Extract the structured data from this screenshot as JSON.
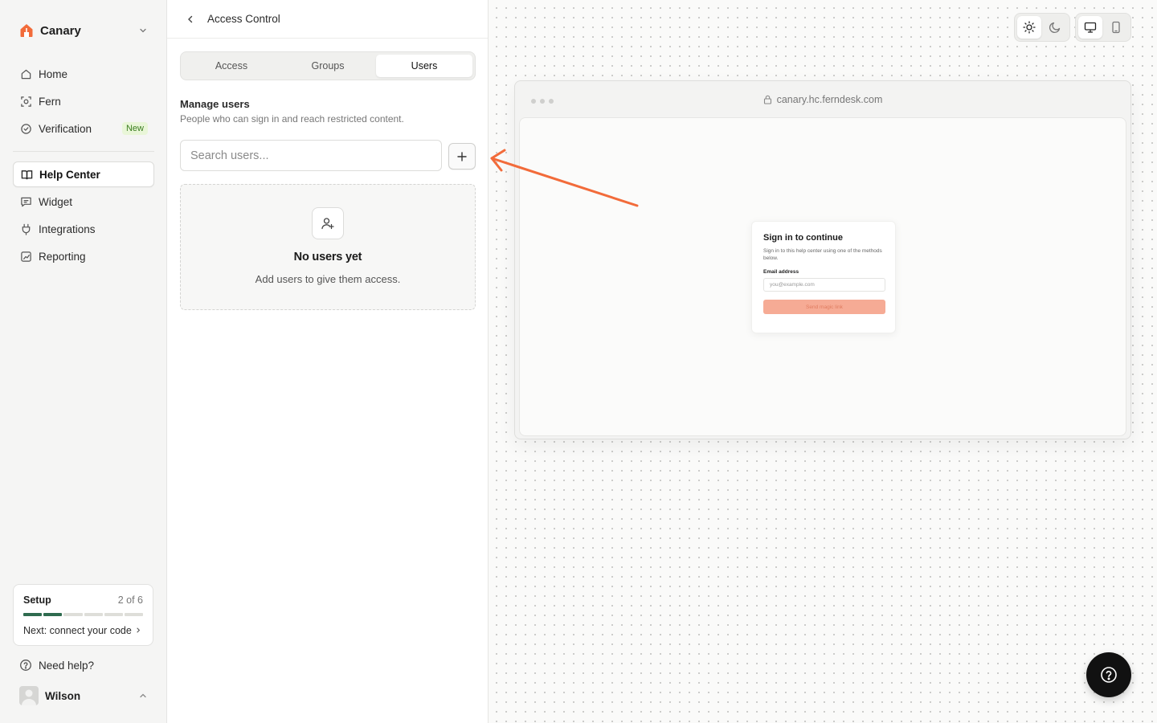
{
  "app": {
    "workspace_name": "Canary",
    "brand_color": "#f26b3a"
  },
  "sidebar": {
    "primary_items": [
      {
        "label": "Home",
        "icon": "home-icon"
      },
      {
        "label": "Fern",
        "icon": "fern-scan-icon"
      },
      {
        "label": "Verification",
        "icon": "check-circle-icon",
        "badge": "New"
      }
    ],
    "secondary_items": [
      {
        "label": "Help Center",
        "icon": "book-open-icon",
        "active": true
      },
      {
        "label": "Widget",
        "icon": "message-square-icon"
      },
      {
        "label": "Integrations",
        "icon": "plug-icon"
      },
      {
        "label": "Reporting",
        "icon": "chart-icon"
      }
    ],
    "setup": {
      "title": "Setup",
      "count": "2 of 6",
      "completed": 2,
      "total": 6,
      "next_label": "Next: connect your code",
      "progress_color": "#2f6b4f"
    },
    "help_label": "Need help?",
    "user_name": "Wilson"
  },
  "panel": {
    "title": "Access Control",
    "tabs": [
      {
        "label": "Access",
        "active": false
      },
      {
        "label": "Groups",
        "active": false
      },
      {
        "label": "Users",
        "active": true
      }
    ],
    "section_title": "Manage users",
    "section_subtitle": "People who can sign in and reach restricted content.",
    "search_placeholder": "Search users...",
    "empty_title": "No users yet",
    "empty_subtitle": "Add users to give them access."
  },
  "preview": {
    "url": "canary.hc.ferndesk.com",
    "signin": {
      "title": "Sign in to continue",
      "subtitle": "Sign in to this help center using one of the methods below.",
      "email_label": "Email address",
      "email_placeholder": "you@example.com",
      "button_label": "Send magic link",
      "button_color": "#f6ab95"
    },
    "annotation_arrow_color": "#f26b3a"
  }
}
